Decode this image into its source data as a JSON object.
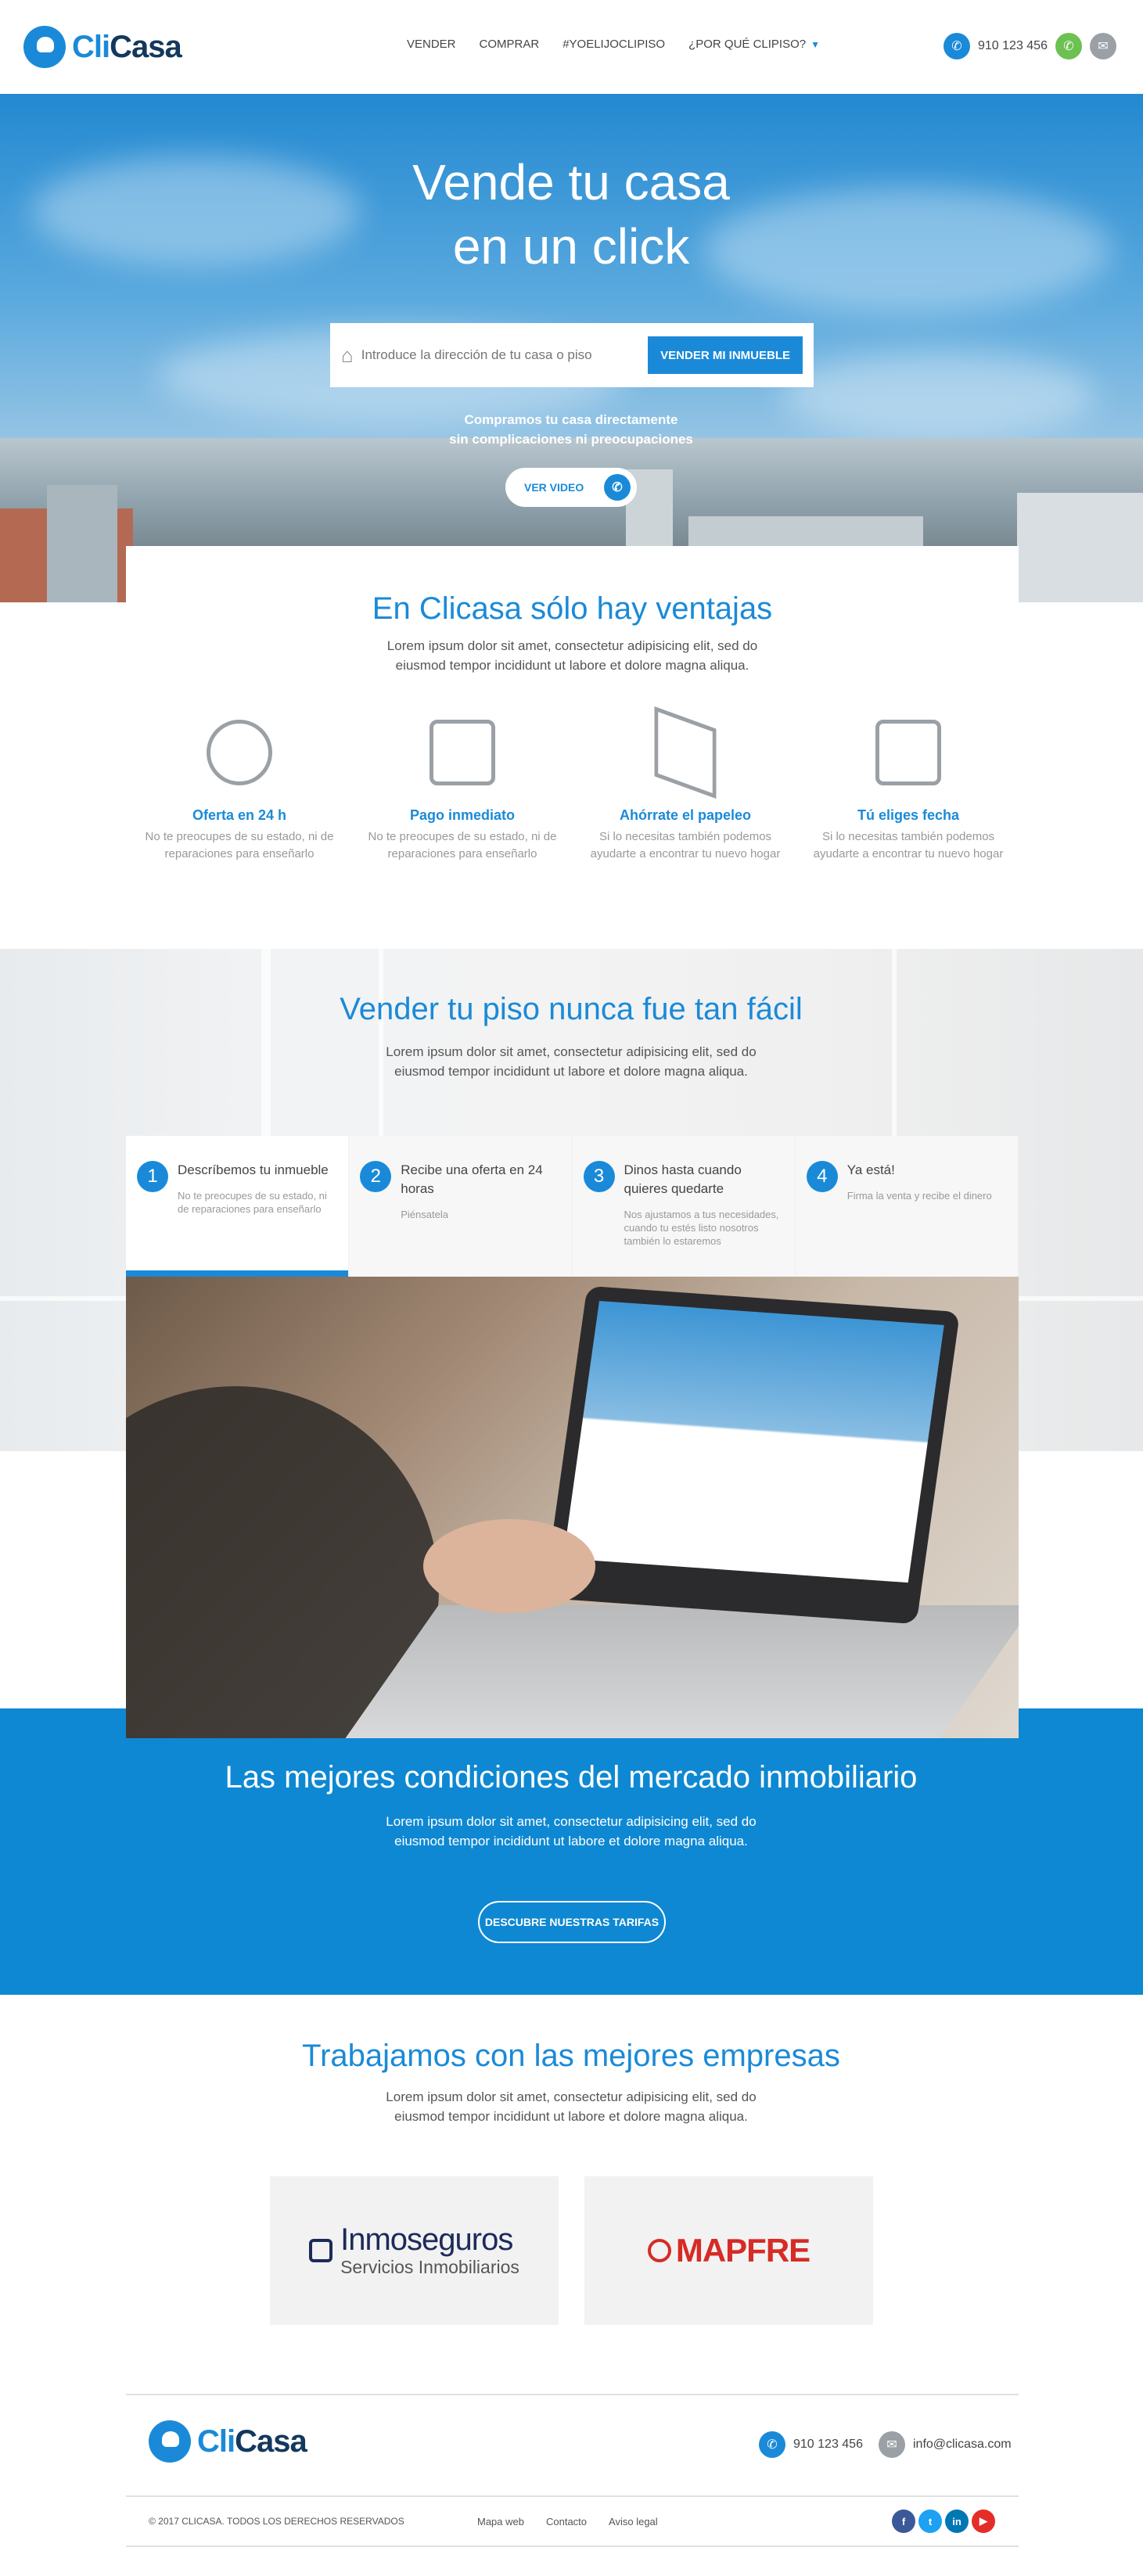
{
  "header": {
    "logo": {
      "part1": "Cli",
      "part2": "Casa"
    },
    "nav": [
      "VENDER",
      "COMPRAR",
      "#YOELIJOCLIPISO",
      "¿POR QUÉ CLIPISO?"
    ],
    "phone": "910 123 456",
    "icons": [
      "phone-icon",
      "whatsapp-icon",
      "mail-icon"
    ]
  },
  "hero": {
    "title_line1": "Vende tu casa",
    "title_line2": "en un click",
    "search_placeholder": "Introduce la dirección de tu casa o piso",
    "cta": "VENDER MI INMUEBLE",
    "sub_line1": "Compramos tu casa directamente",
    "sub_line2": "sin complicaciones ni preocupaciones",
    "video_label": "VER VIDEO"
  },
  "ventajas": {
    "title": "En Clicasa sólo hay ventajas",
    "lead_line1": "Lorem ipsum dolor sit amet, consectetur adipisicing elit, sed do",
    "lead_line2": "eiusmod tempor incididunt ut labore et dolore magna aliqua.",
    "features": [
      {
        "icon": "clock-icon",
        "title": "Oferta en 24 h",
        "desc": "No te preocupes de su estado, ni de reparaciones para enseñarlo"
      },
      {
        "icon": "wallet-icon",
        "title": "Pago inmediato",
        "desc": "No te preocupes de su estado, ni de reparaciones para enseñarlo"
      },
      {
        "icon": "paper-plane-icon",
        "title": "Ahórrate el papeleo",
        "desc": "Si lo necesitas también podemos ayudarte a encontrar tu nuevo hogar"
      },
      {
        "icon": "calendar-check-icon",
        "title": "Tú eliges fecha",
        "desc": "Si lo necesitas también podemos ayudarte a encontrar tu nuevo hogar"
      }
    ]
  },
  "steps": {
    "title": "Vender tu piso nunca fue tan fácil",
    "lead": "Lorem ipsum dolor sit amet, consectetur adipisicing elit, sed do eiusmod tempor incididunt ut labore et dolore magna aliqua.",
    "items": [
      {
        "num": "1",
        "title": "Descríbemos tu inmueble",
        "desc": "No te preocupes de su estado, ni de reparaciones para enseñarlo"
      },
      {
        "num": "2",
        "title": "Recibe una oferta en 24 horas",
        "desc": "Piénsatela"
      },
      {
        "num": "3",
        "title": "Dinos hasta cuando quieres quedarte",
        "desc": "Nos ajustamos a tus necesidades, cuando tu estés listo nosotros también lo estaremos"
      },
      {
        "num": "4",
        "title": "Ya está!",
        "desc": "Firma la venta y recibe el dinero"
      }
    ]
  },
  "condiciones": {
    "title": "Las mejores condiciones del mercado inmobiliario",
    "lead_line1": "Lorem ipsum dolor sit amet, consectetur adipisicing elit, sed do",
    "lead_line2": "eiusmod tempor incididunt ut labore et dolore magna aliqua.",
    "cta": "DESCUBRE NUESTRAS TARIFAS"
  },
  "empresas": {
    "title": "Trabajamos con las mejores empresas",
    "lead_line1": "Lorem ipsum dolor sit amet, consectetur adipisicing elit, sed do",
    "lead_line2": "eiusmod tempor incididunt ut labore et dolore magna aliqua.",
    "partners": [
      {
        "name": "Inmoseguros",
        "tagline": "Servicios Inmobiliarios"
      },
      {
        "name": "MAPFRE"
      }
    ]
  },
  "footer": {
    "phone": "910 123 456",
    "email": "info@clicasa.com",
    "copyright": "© 2017 CLICASA. TODOS LOS DERECHOS RESERVADOS",
    "links": [
      "Mapa web",
      "Contacto",
      "Aviso legal"
    ],
    "social": [
      {
        "icon": "facebook-icon",
        "glyph": "f",
        "color": "#3b5998"
      },
      {
        "icon": "twitter-icon",
        "glyph": "t",
        "color": "#1da1f2"
      },
      {
        "icon": "linkedin-icon",
        "glyph": "in",
        "color": "#0077b5"
      },
      {
        "icon": "youtube-icon",
        "glyph": "▶",
        "color": "#e52d27"
      }
    ]
  },
  "colors": {
    "accent": "#1a8ad8",
    "brand_dark": "#13385e",
    "band": "#0e88d2"
  }
}
